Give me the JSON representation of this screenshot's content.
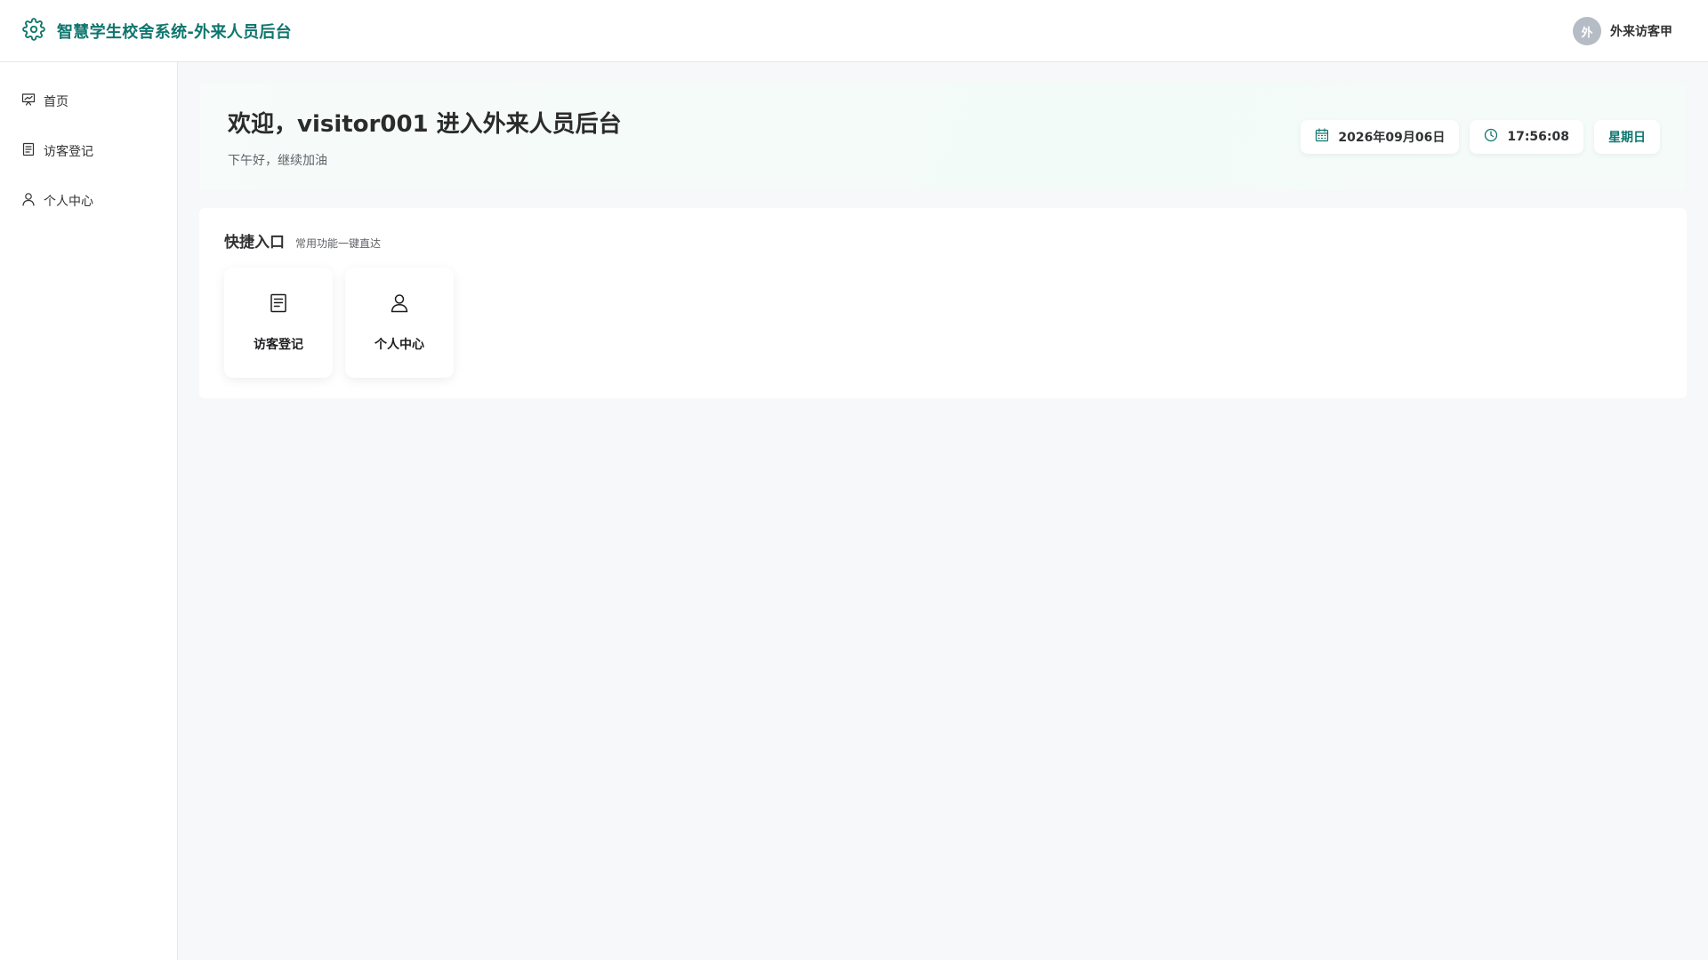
{
  "header": {
    "app_title": "智慧学生校舍系统-外来人员后台",
    "settings_icon": "gear-icon",
    "user": {
      "avatar_text": "外",
      "name": "外来访客甲"
    }
  },
  "sidebar": {
    "items": [
      {
        "label": "首页",
        "icon": "chart-board-icon"
      },
      {
        "label": "访客登记",
        "icon": "document-icon"
      },
      {
        "label": "个人中心",
        "icon": "user-icon"
      }
    ]
  },
  "welcome": {
    "title": "欢迎，visitor001 进入外来人员后台",
    "subtitle": "下午好，继续加油",
    "date": "2026年09月06日",
    "time": "17:56:08",
    "weekday": "星期日"
  },
  "quick": {
    "title": "快捷入口",
    "subtitle": "常用功能一键直达",
    "items": [
      {
        "label": "访客登记",
        "icon": "document-icon"
      },
      {
        "label": "个人中心",
        "icon": "user-icon"
      }
    ]
  },
  "colors": {
    "brand": "#0f766e",
    "avatar_bg": "#b6bcc5",
    "page_bg": "#f7f8fa"
  }
}
